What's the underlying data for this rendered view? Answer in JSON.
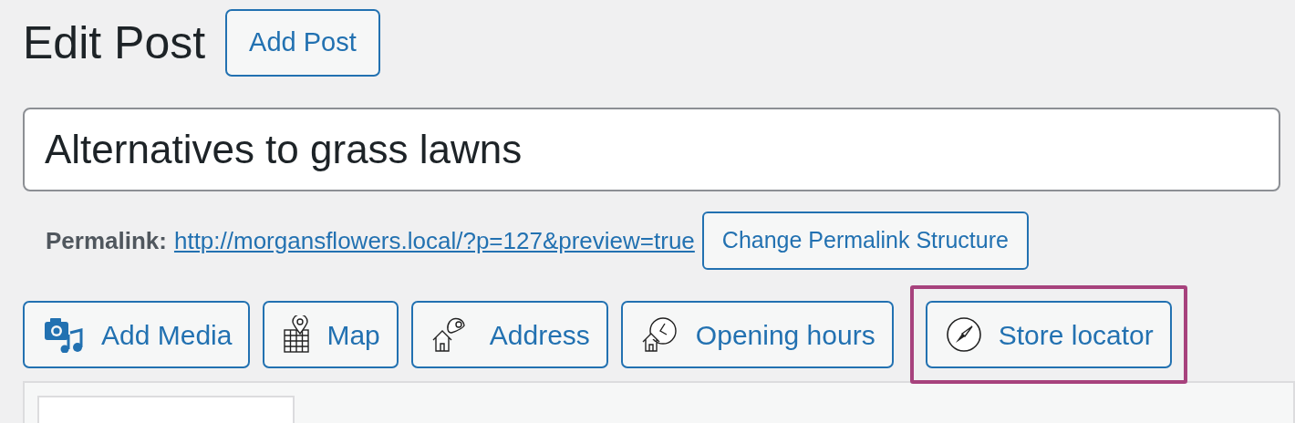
{
  "heading": "Edit Post",
  "add_button": "Add Post",
  "title_field": {
    "value": "Alternatives to grass lawns"
  },
  "permalink": {
    "label": "Permalink:",
    "url": "http://morgansflowers.local/?p=127&preview=true",
    "button": "Change Permalink Structure"
  },
  "media_buttons": [
    {
      "label": "Add Media",
      "kind": "media",
      "highlighted": false
    },
    {
      "label": "Map",
      "kind": "map",
      "highlighted": false
    },
    {
      "label": "Address",
      "kind": "address",
      "highlighted": false
    },
    {
      "label": "Opening hours",
      "kind": "hours",
      "highlighted": false
    },
    {
      "label": "Store locator",
      "kind": "compass",
      "highlighted": true
    }
  ]
}
